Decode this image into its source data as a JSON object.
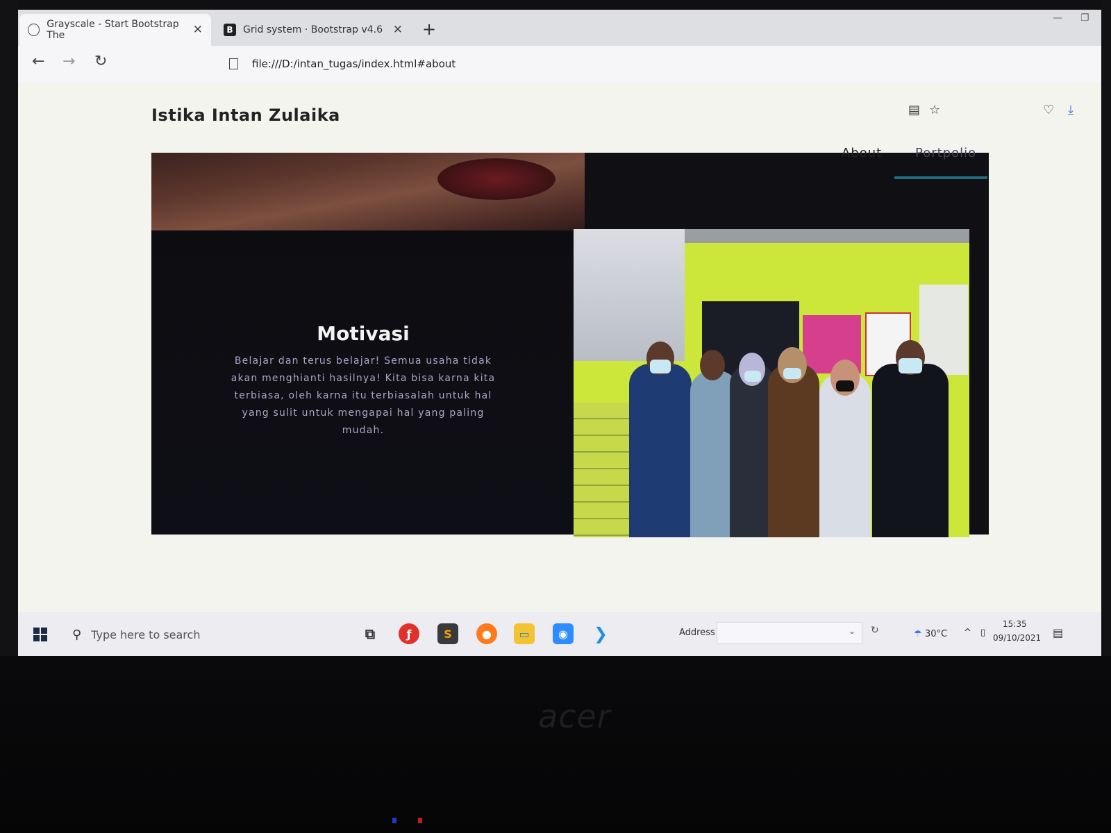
{
  "browser": {
    "tabs": [
      {
        "label": "Grayscale - Start Bootstrap The",
        "active": true,
        "favicon": "globe-icon"
      },
      {
        "label": "Grid system · Bootstrap v4.6",
        "active": false,
        "favicon": "bootstrap-icon"
      }
    ],
    "new_tab_glyph": "+",
    "url": "file:///D:/intan_tugas/index.html#about"
  },
  "page": {
    "brand": "Istika Intan Zulaika",
    "nav": [
      {
        "label": "About"
      },
      {
        "label": "Portpolio"
      }
    ],
    "motivasi": {
      "title": "Motivasi",
      "body": "Belajar dan terus belajar! Semua usaha tidak akan menghianti hasilnya! Kita bisa karna kita terbiasa, oleh karna itu terbiasalah untuk hal yang sulit untuk mengapai hal yang paling mudah."
    }
  },
  "taskbar": {
    "search_placeholder": "Type here to search",
    "address_label": "Address",
    "weather": "30°C",
    "time": "15:35",
    "date": "09/10/2021"
  },
  "device": {
    "brand": "acer"
  },
  "colors": {
    "accent_underline": "#1f6c80",
    "panel_dark": "#0f0f14",
    "body_text": "#a9a8c8"
  }
}
